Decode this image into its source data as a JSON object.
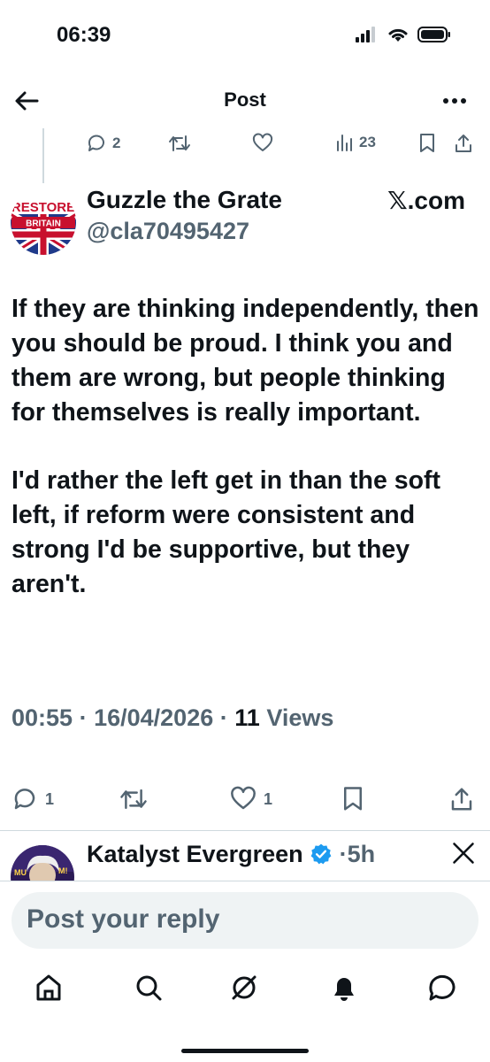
{
  "status_bar": {
    "time": "06:39"
  },
  "header": {
    "title": "Post"
  },
  "mini_actions": {
    "replies": "2",
    "views": "23"
  },
  "post": {
    "author_name": "Guzzle the Grate",
    "author_handle": "@cla70495427",
    "brand": "𝕏.com",
    "avatar_text_top": "RESTORE",
    "avatar_text_bottom": "BRITAIN",
    "paragraphs": [
      "If they are thinking independently, then you should be proud. I think you and them are wrong, but people thinking for themselves is really important.",
      "I'd rather the left get in than the soft left, if reform were consistent and strong I'd be supportive, but they aren't."
    ],
    "time": "00:55",
    "date": "16/04/2026",
    "views_count": "11",
    "views_label": "Views",
    "separator": "·"
  },
  "actions": {
    "replies": "1",
    "likes": "1"
  },
  "reply": {
    "author_name": "Katalyst Evergreen",
    "age": "5h",
    "separator": "·",
    "avatar_text": "MU",
    "avatar_text2": "M!"
  },
  "compose": {
    "placeholder": "Post your reply"
  },
  "colors": {
    "text": "#0f1419",
    "muted": "#536471",
    "verified": "#1d9bf0",
    "compose_bg": "#eff3f4"
  }
}
